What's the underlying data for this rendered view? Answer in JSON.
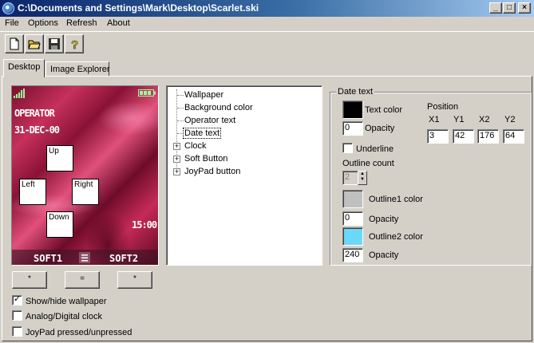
{
  "window": {
    "title": "C:\\Documents and Settings\\Mark\\Desktop\\Scarlet.ski",
    "minimize": "_",
    "maximize": "□",
    "close": "×"
  },
  "menu": [
    "File",
    "Options",
    "Refresh",
    "About"
  ],
  "toolbar": {
    "buttons": [
      "new-icon",
      "open-folder-icon",
      "save-icon",
      "help-icon"
    ]
  },
  "tabs": [
    "Desktop",
    "Image Explorer"
  ],
  "preview": {
    "operator_text": "OPERATOR",
    "date_text": "31-DEC-00",
    "clock_text": "15:00",
    "soft1": "SOFT1",
    "soft2": "SOFT2",
    "joypad": {
      "up": "Up",
      "left": "Left",
      "right": "Right",
      "down": "Down"
    },
    "accent_color": "#c5305c"
  },
  "preview_buttons": [
    "*",
    "=",
    "*"
  ],
  "checkboxes": [
    {
      "label": "Show/hide wallpaper",
      "checked": true
    },
    {
      "label": "Analog/Digital clock",
      "checked": false
    },
    {
      "label": "JoyPad pressed/unpressed",
      "checked": false
    }
  ],
  "tree": [
    {
      "label": "Wallpaper",
      "expandable": false,
      "selected": false
    },
    {
      "label": "Background color",
      "expandable": false,
      "selected": false
    },
    {
      "label": "Operator text",
      "expandable": false,
      "selected": false
    },
    {
      "label": "Date text",
      "expandable": false,
      "selected": true
    },
    {
      "label": "Clock",
      "expandable": true,
      "selected": false
    },
    {
      "label": "Soft Button",
      "expandable": true,
      "selected": false
    },
    {
      "label": "JoyPad button",
      "expandable": true,
      "selected": false
    }
  ],
  "properties": {
    "group_title": "Date text",
    "text_color_label": "Text color",
    "text_color": "#000000",
    "opacity_label": "Opacity",
    "opacity_value": "0",
    "underline_label": "Underline",
    "underline_checked": false,
    "outline_count_label": "Outline count",
    "outline_count_value": "2",
    "outline1_label": "Outline1 color",
    "outline1_color": "#c0c0c0",
    "outline1_opacity": "0",
    "outline2_label": "Outline2 color",
    "outline2_color": "#6cd8f8",
    "outline2_opacity": "240",
    "position_label": "Position",
    "position_headers": [
      "X1",
      "Y1",
      "X2",
      "Y2"
    ],
    "position_values": [
      "3",
      "42",
      "176",
      "64"
    ]
  }
}
